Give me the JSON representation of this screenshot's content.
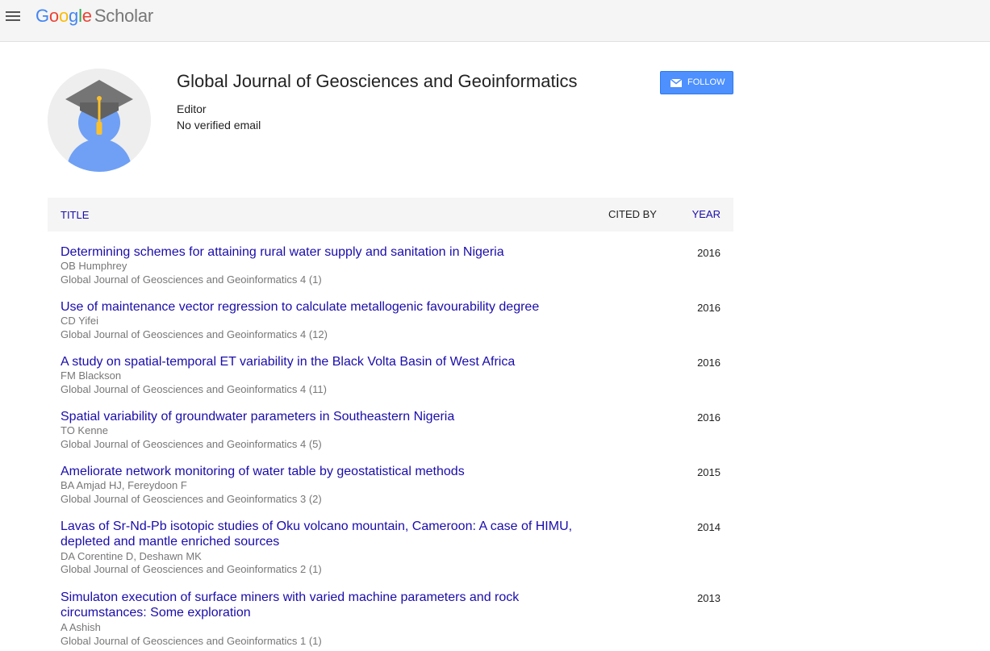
{
  "header": {
    "logo_parts": [
      "G",
      "o",
      "o",
      "g",
      "l",
      "e"
    ],
    "logo_suffix": "Scholar"
  },
  "profile": {
    "name": "Global Journal of Geosciences and Geoinformatics",
    "affiliation": "Editor",
    "email": "No verified email",
    "follow_label": "FOLLOW"
  },
  "table": {
    "col_title": "TITLE",
    "col_cited_by": "CITED BY",
    "col_year": "YEAR",
    "rows": [
      {
        "title": "Determining schemes for attaining rural water supply and sanitation in Nigeria",
        "authors": "OB Humphrey",
        "venue": "Global Journal of Geosciences and Geoinformatics 4 (1)",
        "year": "2016"
      },
      {
        "title": "Use of maintenance vector regression to calculate metallogenic favourability degree",
        "authors": "CD Yifei",
        "venue": "Global Journal of Geosciences and Geoinformatics 4 (12)",
        "year": "2016"
      },
      {
        "title": "A study on spatial-temporal ET variability in the Black Volta Basin of West Africa",
        "authors": "FM Blackson",
        "venue": "Global Journal of Geosciences and Geoinformatics 4 (11)",
        "year": "2016"
      },
      {
        "title": "Spatial variability of groundwater parameters in Southeastern Nigeria",
        "authors": "TO Kenne",
        "venue": "Global Journal of Geosciences and Geoinformatics 4 (5)",
        "year": "2016"
      },
      {
        "title": "Ameliorate network monitoring of water table by geostatistical methods",
        "authors": "BA Amjad HJ, Fereydoon F",
        "venue": "Global Journal of Geosciences and Geoinformatics 3 (2)",
        "year": "2015"
      },
      {
        "title": "Lavas of Sr-Nd-Pb isotopic studies of Oku volcano mountain, Cameroon: A case of HIMU, depleted and mantle enriched sources",
        "authors": "DA Corentine D, Deshawn MK",
        "venue": "Global Journal of Geosciences and Geoinformatics 2 (1)",
        "year": "2014"
      },
      {
        "title": "Simulaton execution of surface miners with varied machine parameters and rock circumstances: Some exploration",
        "authors": "A Ashish",
        "venue": "Global Journal of Geosciences and Geoinformatics 1 (1)",
        "year": "2013"
      }
    ]
  },
  "colors": {
    "link": "#1a0dab",
    "follow_button": "#4d90fe",
    "meta_text": "#777777"
  }
}
